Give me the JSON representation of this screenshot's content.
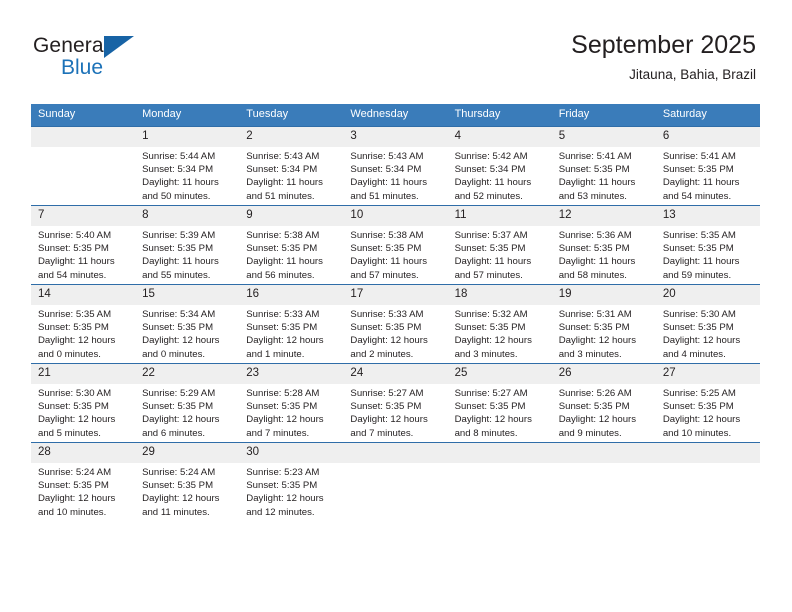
{
  "brand": {
    "name_part1": "General",
    "name_part2": "Blue"
  },
  "header": {
    "title": "September 2025",
    "subtitle": "Jitauna, Bahia, Brazil",
    "accent_color": "#3a7cba",
    "row_border_color": "#2f6da8",
    "daynum_band_color": "#efefef"
  },
  "weekday_headers": [
    "Sunday",
    "Monday",
    "Tuesday",
    "Wednesday",
    "Thursday",
    "Friday",
    "Saturday"
  ],
  "labels": {
    "sunrise_prefix": "Sunrise:",
    "sunset_prefix": "Sunset:",
    "daylight_prefix": "Daylight:"
  },
  "weeks": [
    [
      {
        "day": "",
        "blank": true
      },
      {
        "day": "1",
        "sunrise": "Sunrise: 5:44 AM",
        "sunset": "Sunset: 5:34 PM",
        "daylight_line1": "Daylight: 11 hours",
        "daylight_line2": "and 50 minutes."
      },
      {
        "day": "2",
        "sunrise": "Sunrise: 5:43 AM",
        "sunset": "Sunset: 5:34 PM",
        "daylight_line1": "Daylight: 11 hours",
        "daylight_line2": "and 51 minutes."
      },
      {
        "day": "3",
        "sunrise": "Sunrise: 5:43 AM",
        "sunset": "Sunset: 5:34 PM",
        "daylight_line1": "Daylight: 11 hours",
        "daylight_line2": "and 51 minutes."
      },
      {
        "day": "4",
        "sunrise": "Sunrise: 5:42 AM",
        "sunset": "Sunset: 5:34 PM",
        "daylight_line1": "Daylight: 11 hours",
        "daylight_line2": "and 52 minutes."
      },
      {
        "day": "5",
        "sunrise": "Sunrise: 5:41 AM",
        "sunset": "Sunset: 5:35 PM",
        "daylight_line1": "Daylight: 11 hours",
        "daylight_line2": "and 53 minutes."
      },
      {
        "day": "6",
        "sunrise": "Sunrise: 5:41 AM",
        "sunset": "Sunset: 5:35 PM",
        "daylight_line1": "Daylight: 11 hours",
        "daylight_line2": "and 54 minutes."
      }
    ],
    [
      {
        "day": "7",
        "sunrise": "Sunrise: 5:40 AM",
        "sunset": "Sunset: 5:35 PM",
        "daylight_line1": "Daylight: 11 hours",
        "daylight_line2": "and 54 minutes."
      },
      {
        "day": "8",
        "sunrise": "Sunrise: 5:39 AM",
        "sunset": "Sunset: 5:35 PM",
        "daylight_line1": "Daylight: 11 hours",
        "daylight_line2": "and 55 minutes."
      },
      {
        "day": "9",
        "sunrise": "Sunrise: 5:38 AM",
        "sunset": "Sunset: 5:35 PM",
        "daylight_line1": "Daylight: 11 hours",
        "daylight_line2": "and 56 minutes."
      },
      {
        "day": "10",
        "sunrise": "Sunrise: 5:38 AM",
        "sunset": "Sunset: 5:35 PM",
        "daylight_line1": "Daylight: 11 hours",
        "daylight_line2": "and 57 minutes."
      },
      {
        "day": "11",
        "sunrise": "Sunrise: 5:37 AM",
        "sunset": "Sunset: 5:35 PM",
        "daylight_line1": "Daylight: 11 hours",
        "daylight_line2": "and 57 minutes."
      },
      {
        "day": "12",
        "sunrise": "Sunrise: 5:36 AM",
        "sunset": "Sunset: 5:35 PM",
        "daylight_line1": "Daylight: 11 hours",
        "daylight_line2": "and 58 minutes."
      },
      {
        "day": "13",
        "sunrise": "Sunrise: 5:35 AM",
        "sunset": "Sunset: 5:35 PM",
        "daylight_line1": "Daylight: 11 hours",
        "daylight_line2": "and 59 minutes."
      }
    ],
    [
      {
        "day": "14",
        "sunrise": "Sunrise: 5:35 AM",
        "sunset": "Sunset: 5:35 PM",
        "daylight_line1": "Daylight: 12 hours",
        "daylight_line2": "and 0 minutes."
      },
      {
        "day": "15",
        "sunrise": "Sunrise: 5:34 AM",
        "sunset": "Sunset: 5:35 PM",
        "daylight_line1": "Daylight: 12 hours",
        "daylight_line2": "and 0 minutes."
      },
      {
        "day": "16",
        "sunrise": "Sunrise: 5:33 AM",
        "sunset": "Sunset: 5:35 PM",
        "daylight_line1": "Daylight: 12 hours",
        "daylight_line2": "and 1 minute."
      },
      {
        "day": "17",
        "sunrise": "Sunrise: 5:33 AM",
        "sunset": "Sunset: 5:35 PM",
        "daylight_line1": "Daylight: 12 hours",
        "daylight_line2": "and 2 minutes."
      },
      {
        "day": "18",
        "sunrise": "Sunrise: 5:32 AM",
        "sunset": "Sunset: 5:35 PM",
        "daylight_line1": "Daylight: 12 hours",
        "daylight_line2": "and 3 minutes."
      },
      {
        "day": "19",
        "sunrise": "Sunrise: 5:31 AM",
        "sunset": "Sunset: 5:35 PM",
        "daylight_line1": "Daylight: 12 hours",
        "daylight_line2": "and 3 minutes."
      },
      {
        "day": "20",
        "sunrise": "Sunrise: 5:30 AM",
        "sunset": "Sunset: 5:35 PM",
        "daylight_line1": "Daylight: 12 hours",
        "daylight_line2": "and 4 minutes."
      }
    ],
    [
      {
        "day": "21",
        "sunrise": "Sunrise: 5:30 AM",
        "sunset": "Sunset: 5:35 PM",
        "daylight_line1": "Daylight: 12 hours",
        "daylight_line2": "and 5 minutes."
      },
      {
        "day": "22",
        "sunrise": "Sunrise: 5:29 AM",
        "sunset": "Sunset: 5:35 PM",
        "daylight_line1": "Daylight: 12 hours",
        "daylight_line2": "and 6 minutes."
      },
      {
        "day": "23",
        "sunrise": "Sunrise: 5:28 AM",
        "sunset": "Sunset: 5:35 PM",
        "daylight_line1": "Daylight: 12 hours",
        "daylight_line2": "and 7 minutes."
      },
      {
        "day": "24",
        "sunrise": "Sunrise: 5:27 AM",
        "sunset": "Sunset: 5:35 PM",
        "daylight_line1": "Daylight: 12 hours",
        "daylight_line2": "and 7 minutes."
      },
      {
        "day": "25",
        "sunrise": "Sunrise: 5:27 AM",
        "sunset": "Sunset: 5:35 PM",
        "daylight_line1": "Daylight: 12 hours",
        "daylight_line2": "and 8 minutes."
      },
      {
        "day": "26",
        "sunrise": "Sunrise: 5:26 AM",
        "sunset": "Sunset: 5:35 PM",
        "daylight_line1": "Daylight: 12 hours",
        "daylight_line2": "and 9 minutes."
      },
      {
        "day": "27",
        "sunrise": "Sunrise: 5:25 AM",
        "sunset": "Sunset: 5:35 PM",
        "daylight_line1": "Daylight: 12 hours",
        "daylight_line2": "and 10 minutes."
      }
    ],
    [
      {
        "day": "28",
        "sunrise": "Sunrise: 5:24 AM",
        "sunset": "Sunset: 5:35 PM",
        "daylight_line1": "Daylight: 12 hours",
        "daylight_line2": "and 10 minutes."
      },
      {
        "day": "29",
        "sunrise": "Sunrise: 5:24 AM",
        "sunset": "Sunset: 5:35 PM",
        "daylight_line1": "Daylight: 12 hours",
        "daylight_line2": "and 11 minutes."
      },
      {
        "day": "30",
        "sunrise": "Sunrise: 5:23 AM",
        "sunset": "Sunset: 5:35 PM",
        "daylight_line1": "Daylight: 12 hours",
        "daylight_line2": "and 12 minutes."
      },
      {
        "day": "",
        "blank": true
      },
      {
        "day": "",
        "blank": true
      },
      {
        "day": "",
        "blank": true
      },
      {
        "day": "",
        "blank": true
      }
    ]
  ]
}
